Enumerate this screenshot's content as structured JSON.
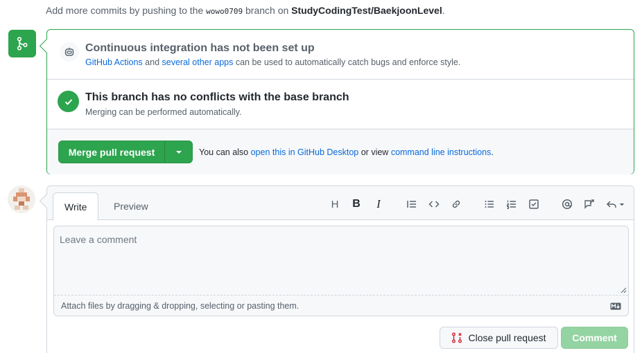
{
  "top_note": {
    "prefix": "Add more commits by pushing to the",
    "branch": "wowo0709",
    "middle": "branch on",
    "repo": "StudyCodingTest/BaekjoonLevel",
    "suffix": "."
  },
  "ci": {
    "title": "Continuous integration has not been set up",
    "link1": "GitHub Actions",
    "and": "and",
    "link2": "several other apps",
    "desc_rest": "can be used to automatically catch bugs and enforce style."
  },
  "conflicts": {
    "title": "This branch has no conflicts with the base branch",
    "desc": "Merging can be performed automatically."
  },
  "merge": {
    "button_label": "Merge pull request",
    "also_prefix": "You can also",
    "desktop_link": "open this in GitHub Desktop",
    "or_view": "or view",
    "cli_link": "command line instructions",
    "suffix": "."
  },
  "comment": {
    "tabs": [
      "Write",
      "Preview"
    ],
    "placeholder": "Leave a comment",
    "attach_text": "Attach files by dragging & dropping, selecting or pasting them."
  },
  "toolbar": {
    "heading_glyph": "H",
    "bold_glyph": "B",
    "italic_glyph": "I",
    "icons": [
      "heading-icon",
      "bold-icon",
      "italic-icon",
      "quote-icon",
      "code-icon",
      "link-icon",
      "bulleted-list-icon",
      "numbered-list-icon",
      "task-list-icon",
      "mention-icon",
      "cross-reference-icon",
      "reply-icon"
    ]
  },
  "buttons": {
    "close_label": "Close pull request",
    "comment_label": "Comment"
  },
  "colors": {
    "success": "#2da44e",
    "link": "#0969da",
    "danger": "#cf222e",
    "comment_disabled": "#94d3a2"
  }
}
